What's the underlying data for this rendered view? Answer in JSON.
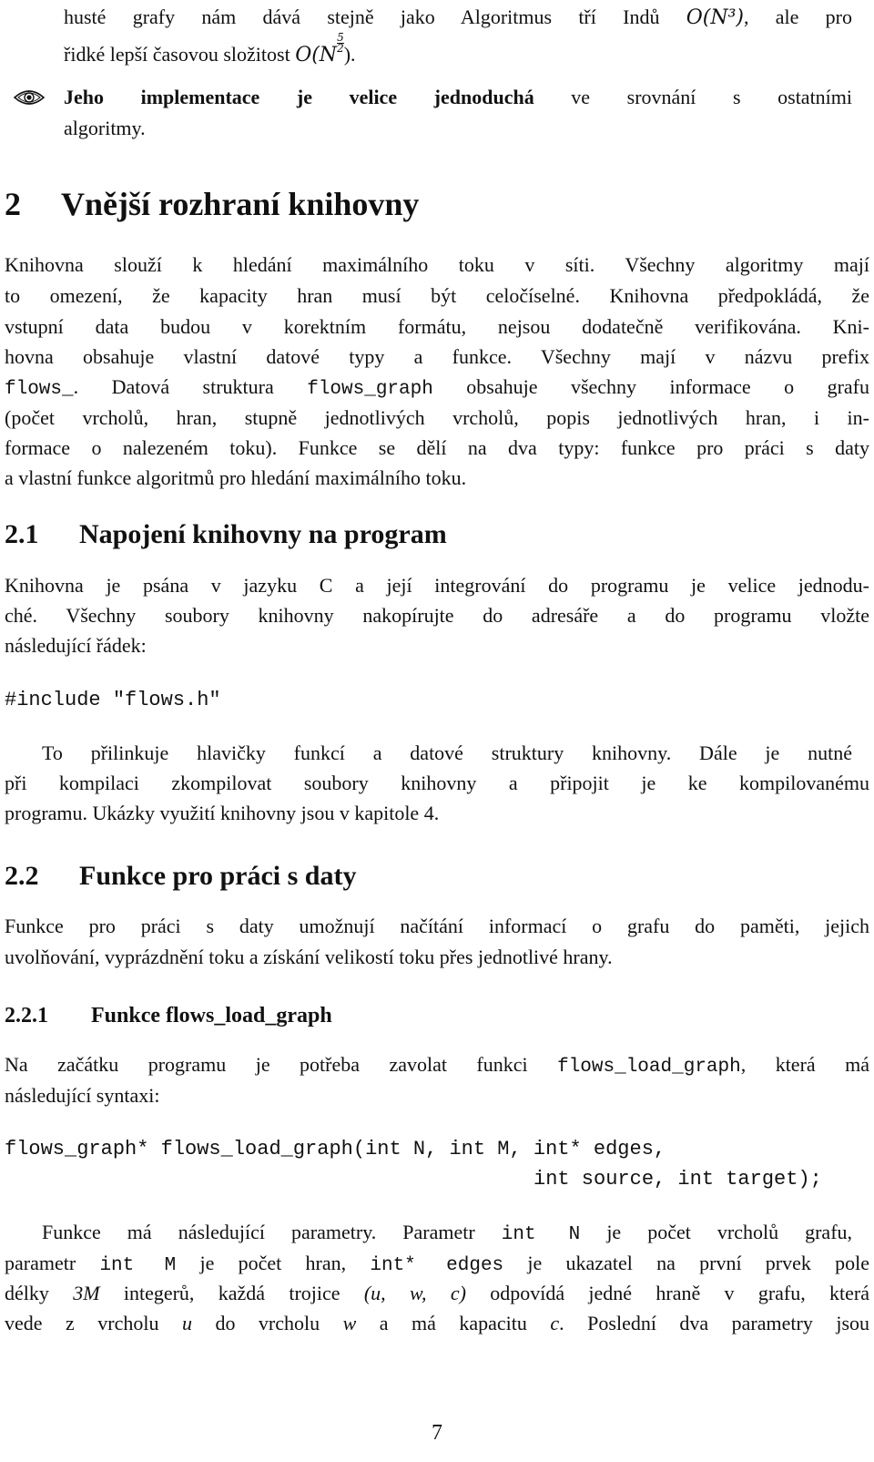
{
  "intro": {
    "line1": "husté grafy nám dává stejně jako Algoritmus tří Indů",
    "line1_complexity": "O(N³)",
    "line1_tail": ", ale pro",
    "line2": "řidké lepší časovou složitost",
    "line2_complexity_base": "O(N",
    "line2_exp_num": "5",
    "line2_exp_den": "2",
    "line2_tail": ")."
  },
  "bullet": {
    "icon": "eye-icon",
    "bold_text": "Jeho implementace je velice jednoduchá",
    "text": "ve srovnání s ostatními",
    "text2": "algoritmy."
  },
  "section2": {
    "number": "2",
    "title": "Vnější rozhraní knihovny",
    "para": [
      "Knihovna slouží k hledání maximálního toku v síti. Všechny algoritmy mají",
      "to omezení, že kapacity hran musí být celočíselné. Knihovna předpokládá, že",
      "vstupní data budou v korektním formátu, nejsou dodatečně verifikována. Kni-",
      "hovna obsahuje vlastní datové typy a funkce. Všechny mají v názvu prefix"
    ],
    "line5_code1": "flows_",
    "line5_mid": ". Datová struktura",
    "line5_code2": "flows_graph",
    "line5_tail": "obsahuje všechny informace o grafu",
    "para_rest": [
      "(počet vrcholů, hran, stupně jednotlivých vrcholů, popis jednotlivých hran, i in-",
      "formace o nalezeném toku). Funkce se dělí na dva typy: funkce pro práci s daty",
      "a vlastní funkce algoritmů pro hledání maximálního toku."
    ]
  },
  "section21": {
    "number": "2.1",
    "title": "Napojení knihovny na program",
    "para": [
      "Knihovna je psána v jazyku C a její integrování do programu je velice jednodu-",
      "ché. Všechny soubory knihovny nakopírujte do adresáře a do programu vložte",
      "následující řádek:"
    ],
    "code": "#include \"flows.h\"",
    "para2": [
      "To přilinkuje hlavičky funkcí a datové struktury knihovny. Dále je nutné",
      "při kompilaci zkompilovat soubory knihovny a připojit je ke kompilovanému",
      "programu. Ukázky využití knihovny jsou v kapitole 4."
    ]
  },
  "section22": {
    "number": "2.2",
    "title": "Funkce pro práci s daty",
    "para": [
      "Funkce pro práci s daty umožnují načítání informací o grafu do paměti, jejich",
      "uvolňování, vyprázdnění toku a získání velikostí toku přes jednotlivé hrany."
    ]
  },
  "section221": {
    "number": "2.2.1",
    "title": "Funkce flows_load_graph",
    "line1_pre": "Na začátku programu je potřeba zavolat funkci",
    "line1_code": "flows_load_graph",
    "line1_tail": ", která má",
    "line2": "následující syntaxi:",
    "code_line1": "flows_graph* flows_load_graph(int N, int M, int* edges,",
    "code_line2": "int source, int target);",
    "p1_pre": "Funkce má následující parametry. Parametr",
    "p1_code": "int N",
    "p1_tail": "je počet vrcholů grafu,",
    "p2_pre": "parametr",
    "p2_code1": "int M",
    "p2_mid": "je počet hran,",
    "p2_code2": "int* edges",
    "p2_tail": "je ukazatel na první prvek pole",
    "p3_pre": "délky",
    "p3_math1": "3M",
    "p3_mid": "integerů, každá trojice",
    "p3_math2": "(u, w, c)",
    "p3_tail": "odpovídá jedné hraně v grafu, která",
    "p4_pre": "vede z vrcholu",
    "p4_u": "u",
    "p4_mid1": "do vrcholu",
    "p4_w": "w",
    "p4_mid2": "a má kapacitu",
    "p4_c": "c",
    "p4_tail": ". Poslední dva parametry jsou"
  },
  "footer": {
    "page_number": "7"
  }
}
